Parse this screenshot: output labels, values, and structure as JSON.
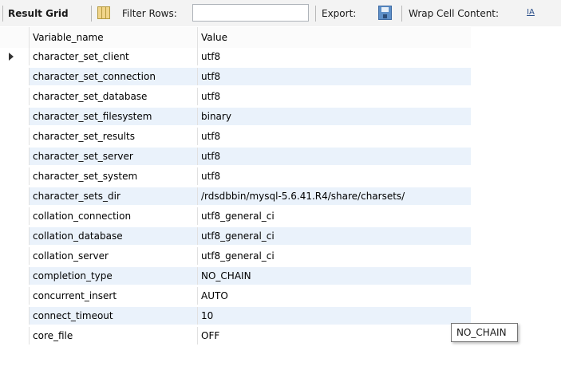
{
  "toolbar": {
    "result_grid_label": "Result Grid",
    "filter_rows_label": "Filter Rows:",
    "filter_value": "",
    "export_label": "Export:",
    "wrap_label": "Wrap Cell Content:",
    "icons": [
      "grid-layout-icon",
      "export-icon",
      "wrap-text-icon"
    ]
  },
  "columns": [
    "Variable_name",
    "Value"
  ],
  "rows": [
    {
      "name": "character_set_client",
      "value": "utf8"
    },
    {
      "name": "character_set_connection",
      "value": "utf8"
    },
    {
      "name": "character_set_database",
      "value": "utf8"
    },
    {
      "name": "character_set_filesystem",
      "value": "binary"
    },
    {
      "name": "character_set_results",
      "value": "utf8"
    },
    {
      "name": "character_set_server",
      "value": "utf8"
    },
    {
      "name": "character_set_system",
      "value": "utf8"
    },
    {
      "name": "character_sets_dir",
      "value": "/rdsdbbin/mysql-5.6.41.R4/share/charsets/"
    },
    {
      "name": "collation_connection",
      "value": "utf8_general_ci"
    },
    {
      "name": "collation_database",
      "value": "utf8_general_ci"
    },
    {
      "name": "collation_server",
      "value": "utf8_general_ci"
    },
    {
      "name": "completion_type",
      "value": "NO_CHAIN"
    },
    {
      "name": "concurrent_insert",
      "value": "AUTO"
    },
    {
      "name": "connect_timeout",
      "value": "10"
    },
    {
      "name": "core_file",
      "value": "OFF"
    }
  ],
  "tooltip": "NO_CHAIN",
  "colors": {
    "alt_row": "#eaf2fb",
    "toolbar_bg": "#f3f3f3"
  }
}
